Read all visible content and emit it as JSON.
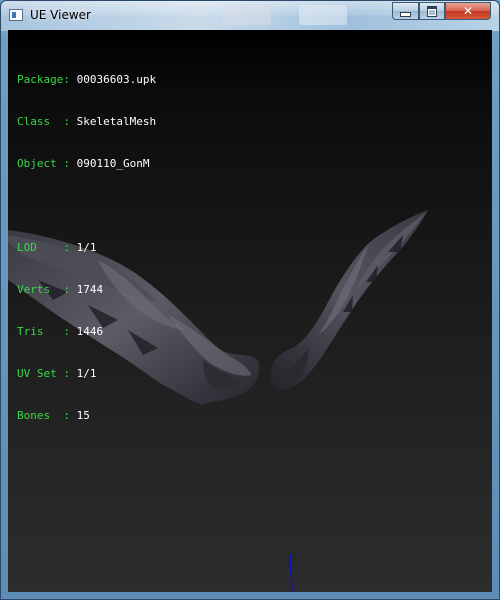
{
  "window": {
    "title": "UE Viewer",
    "controls": {
      "minimize": "minimize",
      "maximize": "maximize",
      "close": "✕"
    }
  },
  "info": {
    "package_label": "Package: ",
    "package_value": "00036603.upk",
    "class_label": "Class  : ",
    "class_value": "SkeletalMesh",
    "object_label": "Object : ",
    "object_value": "090110_GonM",
    "lod_label": "LOD    : ",
    "lod_value": "1/1",
    "verts_label": "Verts  : ",
    "verts_value": "1744",
    "tris_label": "Tris   : ",
    "tris_value": "1446",
    "uvset_label": "UV Set : ",
    "uvset_value": "1/1",
    "bones_label": "Bones  : ",
    "bones_value": "15"
  },
  "colors": {
    "label": "#39d84a",
    "value": "#ffffff",
    "axis": "#1010c8",
    "wing_dark": "#2a2a32",
    "wing_light": "#5a5a66"
  },
  "icons": {
    "app": "ue-viewer-app-icon",
    "minimize": "minimize-icon",
    "maximize": "maximize-icon",
    "close": "close-icon"
  }
}
